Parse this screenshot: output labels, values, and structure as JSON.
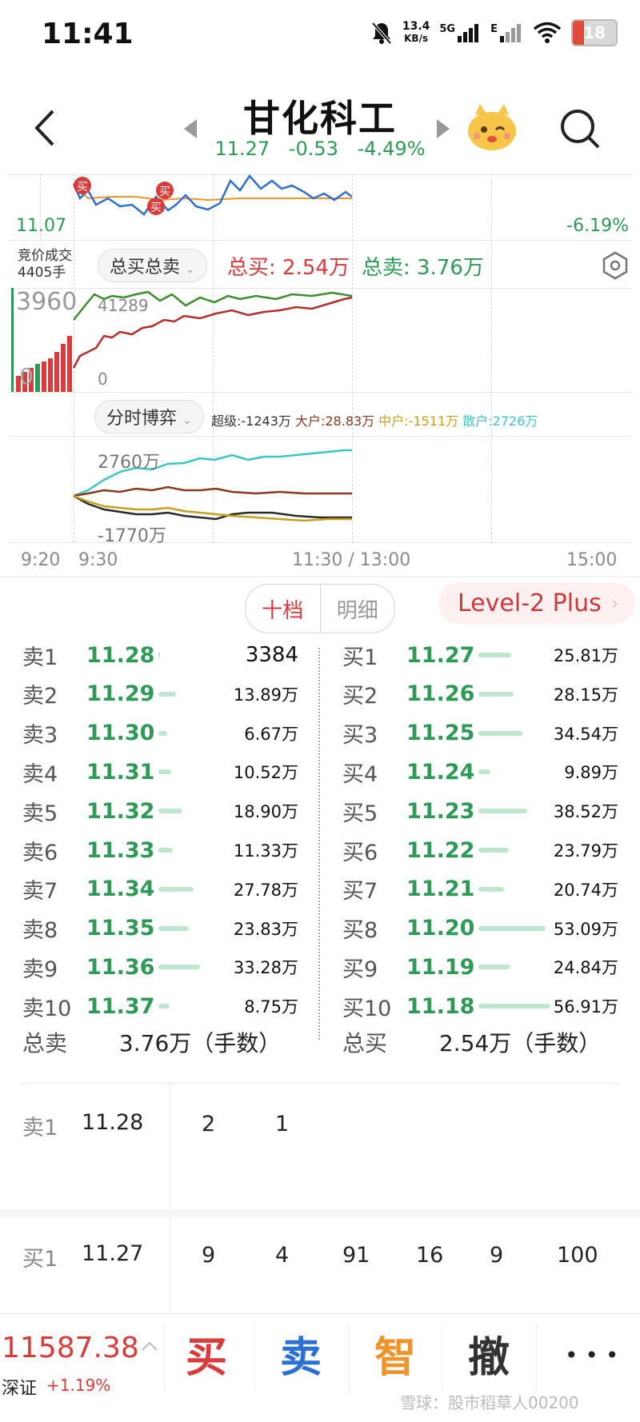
{
  "status_bar": {
    "time": "11:41",
    "net_speed": "13.4",
    "net_unit": "KB/s",
    "network": "5G",
    "network2": "E",
    "battery": "18",
    "icons": [
      "mute-bell-icon",
      "signal-icon",
      "wifi-icon",
      "battery-icon"
    ]
  },
  "header": {
    "title": "甘化科工",
    "price": "11.27",
    "change": "-0.53",
    "change_pct": "-4.49%",
    "icons": [
      "back-arrow-icon",
      "prev-stock-icon",
      "next-stock-icon",
      "mascot-icon",
      "search-icon"
    ]
  },
  "chart": {
    "price_low_label": "11.07",
    "pct_low_label": "-6.19%",
    "buy_marks": [
      "买",
      "买",
      "买"
    ],
    "auction_label_1": "竞价成交",
    "auction_label_2": "4405手",
    "selector_label": "总买总卖",
    "total_buy_label": "总买: 2.54万",
    "total_sell_label": "总卖: 3.76万",
    "vol_max_left": "3960",
    "vol_zero_left": "0",
    "vol_max": "41289",
    "vol_zero": "0",
    "game_label": "分时博弈",
    "super_label": "超级:-1243万",
    "large_label": "大户:28.83万",
    "medium_label": "中户:-1511万",
    "retail_label": "散户:2726万",
    "flow_max": "2760万",
    "flow_min": "-1770万",
    "time_start": "9:20",
    "time_open": "9:30",
    "time_mid": "11:30 / 13:00",
    "time_end": "15:00",
    "colors": {
      "price_line": "#2f6fd0",
      "avg_line": "#f0932b",
      "buy_line": "#3a8f2f",
      "sell_line": "#b52e2e",
      "super": "#2a2a2a",
      "large": "#8a3a1e",
      "medium": "#c8a020",
      "retail": "#3cc6c0"
    }
  },
  "tabs": {
    "ten_levels": "十档",
    "detail": "明细",
    "level2": "Level-2 Plus"
  },
  "order_book": {
    "sell": [
      {
        "label": "卖1",
        "price": "11.28",
        "volume": "3384",
        "bar": 0.0
      },
      {
        "label": "卖2",
        "price": "11.29",
        "volume": "13.89万",
        "bar": 0.24
      },
      {
        "label": "卖3",
        "price": "11.30",
        "volume": "6.67万",
        "bar": 0.12
      },
      {
        "label": "卖4",
        "price": "11.31",
        "volume": "10.52万",
        "bar": 0.18
      },
      {
        "label": "卖5",
        "price": "11.32",
        "volume": "18.90万",
        "bar": 0.33
      },
      {
        "label": "卖6",
        "price": "11.33",
        "volume": "11.33万",
        "bar": 0.2
      },
      {
        "label": "卖7",
        "price": "11.34",
        "volume": "27.78万",
        "bar": 0.49
      },
      {
        "label": "卖8",
        "price": "11.35",
        "volume": "23.83万",
        "bar": 0.42
      },
      {
        "label": "卖9",
        "price": "11.36",
        "volume": "33.28万",
        "bar": 0.58
      },
      {
        "label": "卖10",
        "price": "11.37",
        "volume": "8.75万",
        "bar": 0.15
      }
    ],
    "buy": [
      {
        "label": "买1",
        "price": "11.27",
        "volume": "25.81万",
        "bar": 0.45
      },
      {
        "label": "买2",
        "price": "11.26",
        "volume": "28.15万",
        "bar": 0.49
      },
      {
        "label": "买3",
        "price": "11.25",
        "volume": "34.54万",
        "bar": 0.61
      },
      {
        "label": "买4",
        "price": "11.24",
        "volume": "9.89万",
        "bar": 0.17
      },
      {
        "label": "买5",
        "price": "11.23",
        "volume": "38.52万",
        "bar": 0.68
      },
      {
        "label": "买6",
        "price": "11.22",
        "volume": "23.79万",
        "bar": 0.42
      },
      {
        "label": "买7",
        "price": "11.21",
        "volume": "20.74万",
        "bar": 0.36
      },
      {
        "label": "买8",
        "price": "11.20",
        "volume": "53.09万",
        "bar": 0.93
      },
      {
        "label": "买9",
        "price": "11.19",
        "volume": "24.84万",
        "bar": 0.44
      },
      {
        "label": "买10",
        "price": "11.18",
        "volume": "56.91万",
        "bar": 1.0
      }
    ],
    "total_sell_label": "总卖",
    "total_sell_value": "3.76万（手数）",
    "total_buy_label": "总买",
    "total_buy_value": "2.54万（手数）"
  },
  "queue": {
    "sell1_label": "卖1",
    "sell1_price": "11.28",
    "sell1_orders": [
      "2",
      "1"
    ],
    "buy1_label": "买1",
    "buy1_price": "11.27",
    "buy1_orders": [
      "9",
      "4",
      "91",
      "16",
      "9",
      "100"
    ]
  },
  "bottom": {
    "index_value": "11587.38",
    "index_name": "深证",
    "index_change": "+1.19%",
    "buy": "买",
    "sell": "卖",
    "smart": "智",
    "cancel": "撤",
    "more": "• • •",
    "watermark": "雪球：股市稻草人00200"
  }
}
